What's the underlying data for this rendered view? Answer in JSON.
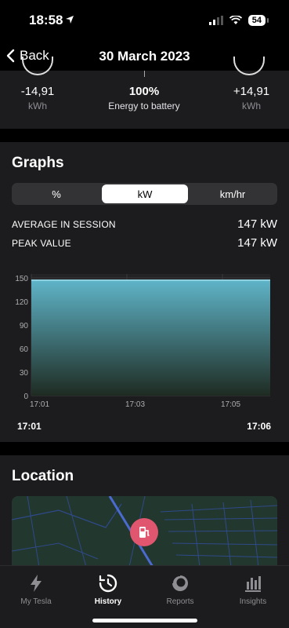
{
  "status_bar": {
    "time": "18:58",
    "battery": "54"
  },
  "nav": {
    "back_label": "Back",
    "title": "30 March 2023"
  },
  "energy": {
    "left_value": "-14,91",
    "left_unit": "kWh",
    "middle_value": "100%",
    "middle_label": "Energy to battery",
    "right_value": "+14,91",
    "right_unit": "kWh"
  },
  "graphs": {
    "title": "Graphs",
    "segments": [
      "%",
      "kW",
      "km/hr"
    ],
    "selected_segment": "kW",
    "stats": [
      {
        "label": "AVERAGE IN SESSION",
        "value": "147 kW"
      },
      {
        "label": "PEAK VALUE",
        "value": "147 kW"
      }
    ],
    "start_time": "17:01",
    "end_time": "17:06"
  },
  "chart_data": {
    "type": "area",
    "x_ticks": [
      "17:01",
      "17:03",
      "17:05"
    ],
    "y_ticks": [
      0,
      30,
      60,
      90,
      120,
      150
    ],
    "ylim": [
      0,
      155
    ],
    "series": [
      {
        "x": [
          "17:01",
          "17:02",
          "17:03",
          "17:04",
          "17:05",
          "17:06"
        ],
        "values": [
          147,
          147,
          147,
          147,
          147,
          147
        ]
      }
    ],
    "grid": true,
    "colors": {
      "top": "#5fb4c8",
      "bottom": "#1e2b22",
      "line": "#8fd0e0"
    }
  },
  "location": {
    "title": "Location"
  },
  "tabs": [
    {
      "label": "My Tesla",
      "icon": "lightning-icon"
    },
    {
      "label": "History",
      "icon": "history-clock-icon"
    },
    {
      "label": "Reports",
      "icon": "reports-icon"
    },
    {
      "label": "Insights",
      "icon": "insights-bar-chart-icon"
    }
  ],
  "active_tab": "History"
}
